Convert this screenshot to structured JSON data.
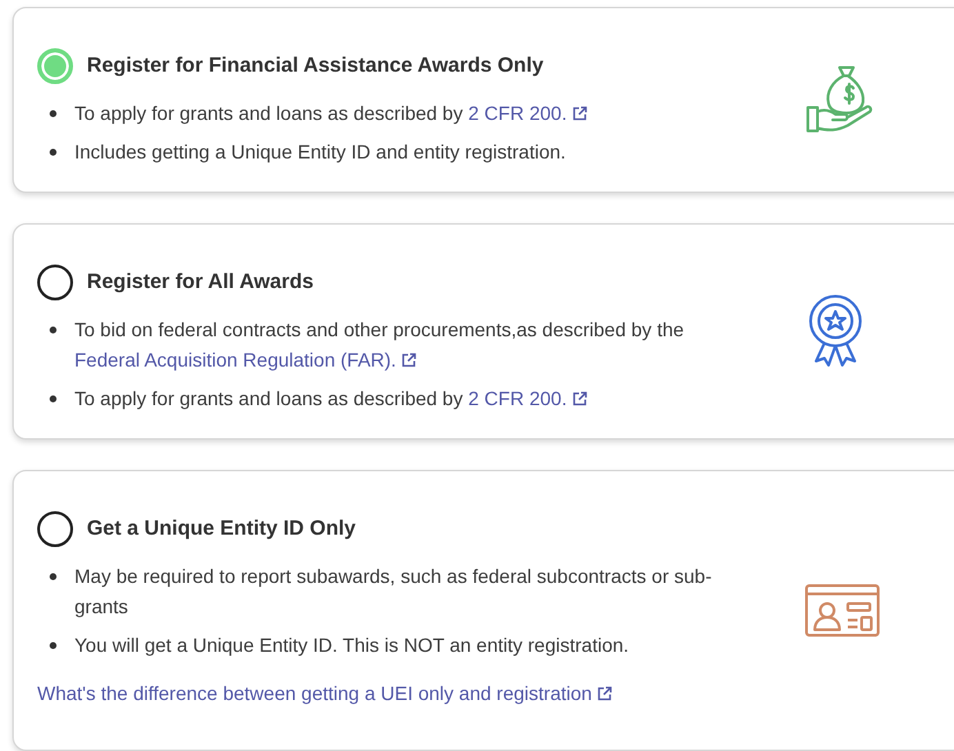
{
  "options": [
    {
      "title": "Register for Financial Assistance Awards Only",
      "selected": true,
      "bullets": [
        {
          "text": "To apply for grants and loans as described by ",
          "link": "2 CFR 200."
        },
        {
          "text": "Includes getting a Unique Entity ID and entity registration."
        }
      ]
    },
    {
      "title": "Register for All Awards",
      "selected": false,
      "bullets": [
        {
          "text": "To bid on federal contracts and other procurements,as described by the ",
          "link": "Federal Acquisition Regulation (FAR)."
        },
        {
          "text": "To apply for grants and loans as described by ",
          "link": "2 CFR 200."
        }
      ]
    },
    {
      "title": "Get a Unique Entity ID Only",
      "selected": false,
      "bullets": [
        {
          "text": "May be required to report subawards, such as federal subcontracts or sub-grants"
        },
        {
          "text": "You will get a Unique Entity ID. This is NOT an entity registration."
        }
      ],
      "footer_link": "What's the difference between getting a UEI only and registration"
    }
  ]
}
